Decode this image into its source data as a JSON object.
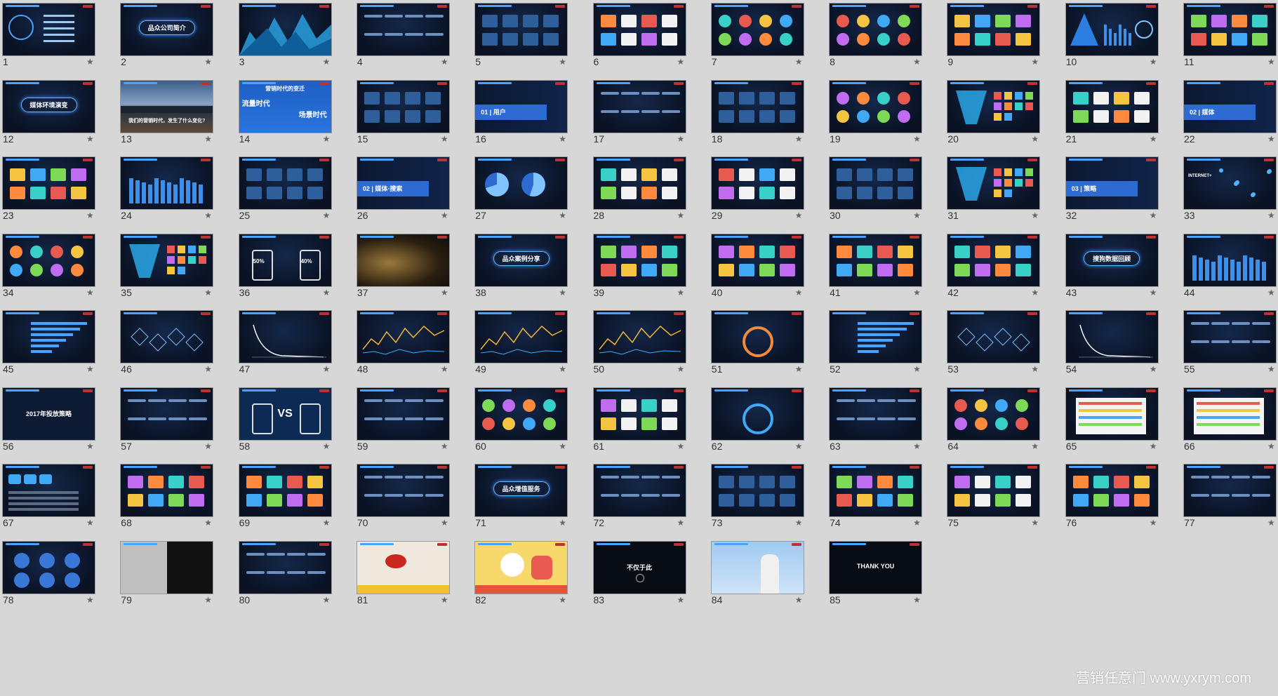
{
  "slides": [
    {
      "number": "1",
      "style": "menu"
    },
    {
      "number": "2",
      "style": "pill",
      "caption": "品众公司简介"
    },
    {
      "number": "3",
      "style": "mountains"
    },
    {
      "number": "4",
      "style": "steps"
    },
    {
      "number": "5",
      "style": "grid"
    },
    {
      "number": "6",
      "style": "cards"
    },
    {
      "number": "7",
      "style": "balloons"
    },
    {
      "number": "8",
      "style": "circles"
    },
    {
      "number": "9",
      "style": "images"
    },
    {
      "number": "10",
      "style": "pyramid"
    },
    {
      "number": "11",
      "style": "logos"
    },
    {
      "number": "12",
      "style": "pill",
      "caption": "媒体环境演变"
    },
    {
      "number": "13",
      "style": "city",
      "caption": "我们的营销时代，发生了什么变化?"
    },
    {
      "number": "14",
      "style": "banner",
      "caption": "营销时代的变迁",
      "caption2": "流量时代",
      "caption3": "场景时代"
    },
    {
      "number": "15",
      "style": "triangle"
    },
    {
      "number": "16",
      "style": "stripe",
      "caption": "01 | 用户"
    },
    {
      "number": "17",
      "style": "lines"
    },
    {
      "number": "18",
      "style": "network"
    },
    {
      "number": "19",
      "style": "circles"
    },
    {
      "number": "20",
      "style": "funnel"
    },
    {
      "number": "21",
      "style": "cards"
    },
    {
      "number": "22",
      "style": "stripe",
      "caption": "02 | 媒体"
    },
    {
      "number": "23",
      "style": "images"
    },
    {
      "number": "24",
      "style": "bars"
    },
    {
      "number": "25",
      "style": "grid"
    },
    {
      "number": "26",
      "style": "stripe",
      "caption": "02 | 媒体·搜索"
    },
    {
      "number": "27",
      "style": "pies"
    },
    {
      "number": "28",
      "style": "cards"
    },
    {
      "number": "29",
      "style": "cards"
    },
    {
      "number": "30",
      "style": "grid"
    },
    {
      "number": "31",
      "style": "hourglass"
    },
    {
      "number": "32",
      "style": "stripe",
      "caption": "03 | 策略"
    },
    {
      "number": "33",
      "style": "network",
      "caption": "INTERNET+"
    },
    {
      "number": "34",
      "style": "circles"
    },
    {
      "number": "35",
      "style": "funnel"
    },
    {
      "number": "36",
      "style": "phones",
      "caption": "50%",
      "caption2": "40%"
    },
    {
      "number": "37",
      "style": "gold"
    },
    {
      "number": "38",
      "style": "pill",
      "caption": "品众案例分享"
    },
    {
      "number": "39",
      "style": "images"
    },
    {
      "number": "40",
      "style": "images"
    },
    {
      "number": "41",
      "style": "images"
    },
    {
      "number": "42",
      "style": "images"
    },
    {
      "number": "43",
      "style": "pill",
      "caption": "搜狗数据回顾"
    },
    {
      "number": "44",
      "style": "bars"
    },
    {
      "number": "45",
      "style": "hbars"
    },
    {
      "number": "46",
      "style": "hexes"
    },
    {
      "number": "47",
      "style": "decay"
    },
    {
      "number": "48",
      "style": "linechart"
    },
    {
      "number": "49",
      "style": "linechart"
    },
    {
      "number": "50",
      "style": "linechart"
    },
    {
      "number": "51",
      "style": "donut"
    },
    {
      "number": "52",
      "style": "hbars"
    },
    {
      "number": "53",
      "style": "hexes"
    },
    {
      "number": "54",
      "style": "decay"
    },
    {
      "number": "55",
      "style": "lines"
    },
    {
      "number": "56",
      "style": "title",
      "caption": "2017年投放策略"
    },
    {
      "number": "57",
      "style": "table"
    },
    {
      "number": "58",
      "style": "vs",
      "caption": "VS"
    },
    {
      "number": "59",
      "style": "lines"
    },
    {
      "number": "60",
      "style": "circles"
    },
    {
      "number": "61",
      "style": "cards"
    },
    {
      "number": "62",
      "style": "ring"
    },
    {
      "number": "63",
      "style": "lines"
    },
    {
      "number": "64",
      "style": "circles"
    },
    {
      "number": "65",
      "style": "whitepanel"
    },
    {
      "number": "66",
      "style": "whitepanel"
    },
    {
      "number": "67",
      "style": "arrows"
    },
    {
      "number": "68",
      "style": "images"
    },
    {
      "number": "69",
      "style": "images"
    },
    {
      "number": "70",
      "style": "lines"
    },
    {
      "number": "71",
      "style": "pill",
      "caption": "品众增值服务"
    },
    {
      "number": "72",
      "style": "tree"
    },
    {
      "number": "73",
      "style": "network"
    },
    {
      "number": "74",
      "style": "images"
    },
    {
      "number": "75",
      "style": "cards"
    },
    {
      "number": "76",
      "style": "images"
    },
    {
      "number": "77",
      "style": "lines"
    },
    {
      "number": "78",
      "style": "bubbles"
    },
    {
      "number": "79",
      "style": "sketch"
    },
    {
      "number": "80",
      "style": "table"
    },
    {
      "number": "81",
      "style": "eyes"
    },
    {
      "number": "82",
      "style": "panda"
    },
    {
      "number": "83",
      "style": "title",
      "caption": "不仅于此"
    },
    {
      "number": "84",
      "style": "photo"
    },
    {
      "number": "85",
      "style": "title",
      "caption": "THANK YOU"
    }
  ],
  "star_glyph": "★",
  "watermark": "营销任意门 www.yxrym.com",
  "colors": {
    "background": "#d7d7d7",
    "slide_dark": "#0a1224",
    "accent_blue": "#2d6bd3",
    "glow": "#3b8cff"
  }
}
